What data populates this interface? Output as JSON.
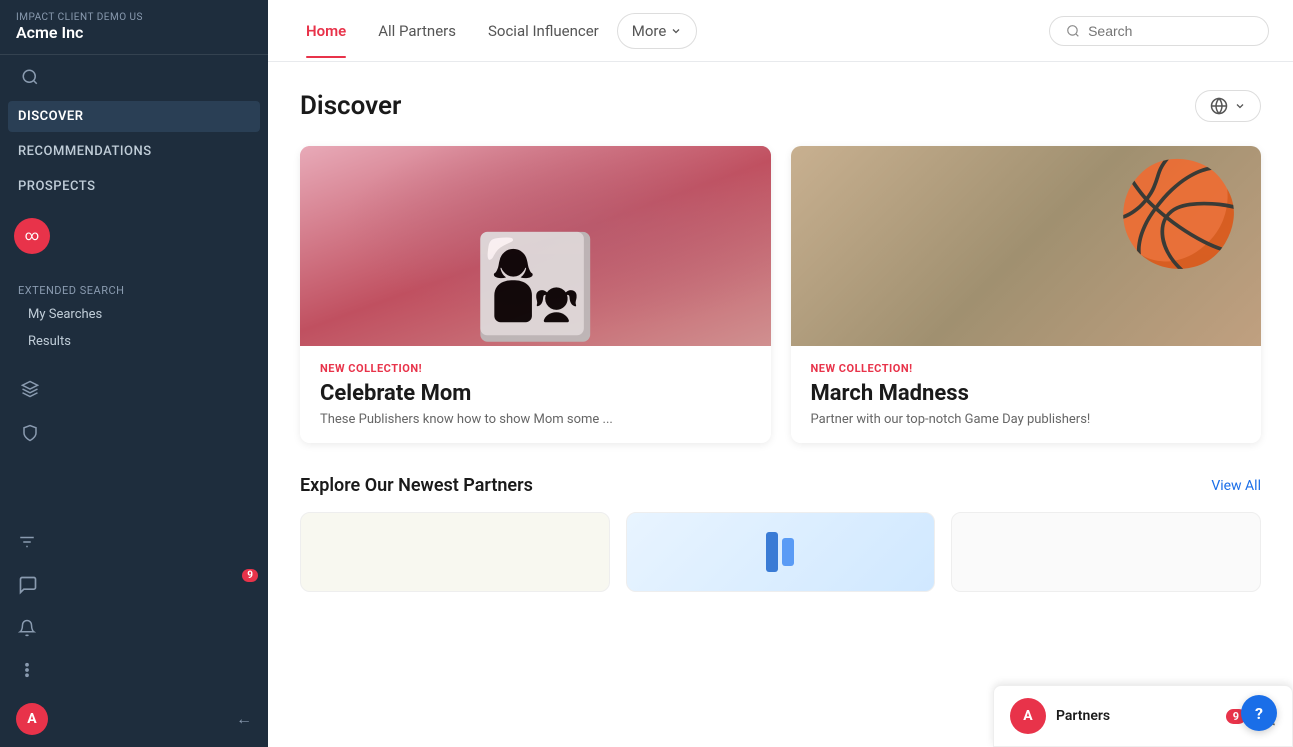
{
  "brand": {
    "sub_label": "Impact Client Demo US",
    "name": "Acme Inc"
  },
  "sidebar": {
    "discover_label": "DISCOVER",
    "recommendations_label": "RECOMMENDATIONS",
    "prospects_label": "PROSPECTS",
    "extended_search_label": "EXTENDED SEARCH",
    "my_searches_label": "My Searches",
    "results_label": "Results"
  },
  "top_nav": {
    "links": [
      {
        "label": "Home",
        "active": true
      },
      {
        "label": "All Partners",
        "active": false
      },
      {
        "label": "Social Influencer",
        "active": false
      }
    ],
    "more_label": "More",
    "search_placeholder": "Search"
  },
  "discover": {
    "title": "Discover",
    "globe_button_label": "🌐",
    "cards": [
      {
        "tag": "NEW COLLECTION!",
        "title": "Celebrate Mom",
        "desc": "These Publishers know how to show Mom some ...",
        "type": "mom"
      },
      {
        "tag": "NEW COLLECTION!",
        "title": "March Madness",
        "desc": "Partner with our top-notch Game Day publishers!",
        "type": "basketball"
      }
    ]
  },
  "newest_partners": {
    "title": "Explore Our Newest Partners",
    "view_all_label": "View All"
  },
  "bottom_toast": {
    "avatar_letter": "A",
    "text": "Partners",
    "badge_count": "9"
  },
  "help_btn": "?"
}
